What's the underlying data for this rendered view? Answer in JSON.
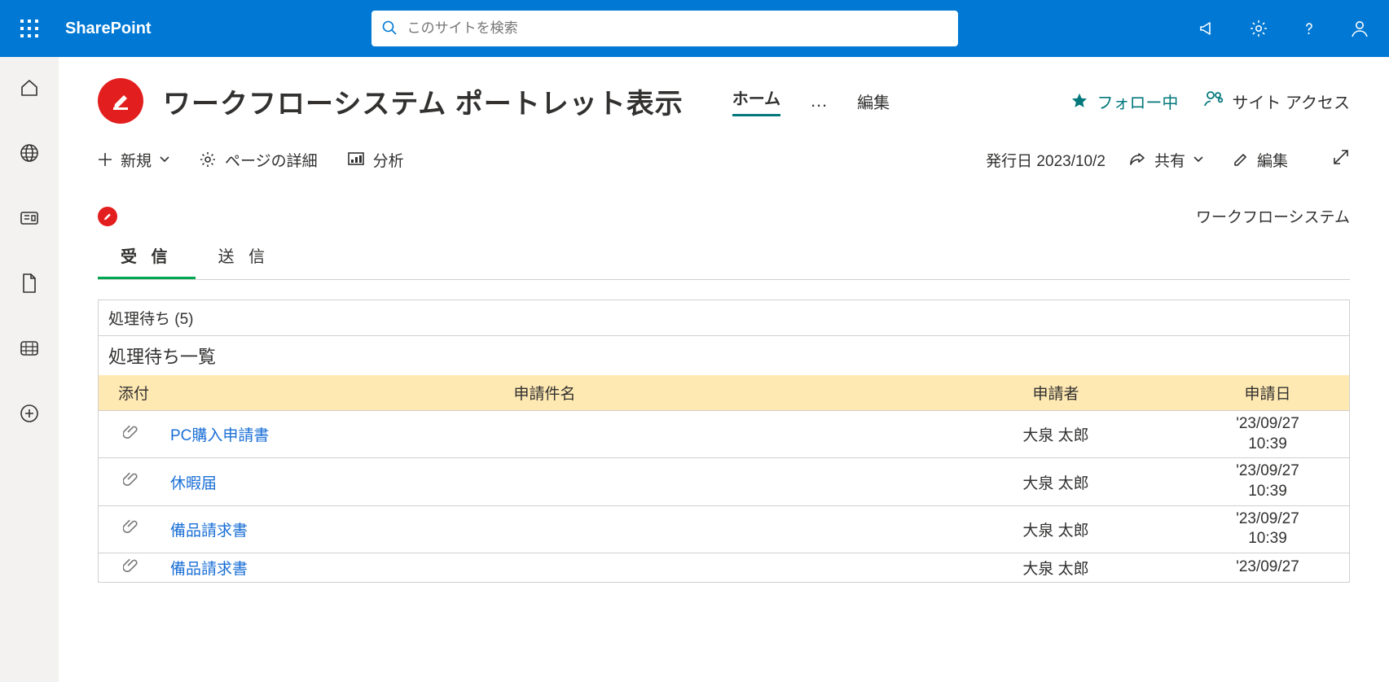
{
  "suite": {
    "brand": "SharePoint",
    "search_placeholder": "このサイトを検索"
  },
  "site": {
    "title": "ワークフローシステム ポートレット表示",
    "nav_home": "ホーム",
    "nav_ellipsis": "…",
    "nav_edit": "編集",
    "follow_label": "フォロー中",
    "access_label": "サイト アクセス"
  },
  "commandbar": {
    "new": "新規",
    "page_details": "ページの詳細",
    "analytics": "分析",
    "publish_date": "発行日 2023/10/2",
    "share": "共有",
    "edit": "編集"
  },
  "webpart": {
    "system_name": "ワークフローシステム",
    "tab_inbox": "受 信",
    "tab_sent": "送 信",
    "pending_header": "処理待ち (5)",
    "pending_title": "処理待ち一覧",
    "columns": {
      "attach": "添付",
      "subject": "申請件名",
      "applicant": "申請者",
      "date": "申請日"
    },
    "rows": [
      {
        "subject": "PC購入申請書",
        "applicant": "大泉 太郎",
        "date1": "'23/09/27",
        "date2": "10:39"
      },
      {
        "subject": "休暇届",
        "applicant": "大泉 太郎",
        "date1": "'23/09/27",
        "date2": "10:39"
      },
      {
        "subject": "備品請求書",
        "applicant": "大泉 太郎",
        "date1": "'23/09/27",
        "date2": "10:39"
      },
      {
        "subject": "備品請求書",
        "applicant": "大泉 太郎",
        "date1": "'23/09/27",
        "date2": ""
      }
    ]
  }
}
